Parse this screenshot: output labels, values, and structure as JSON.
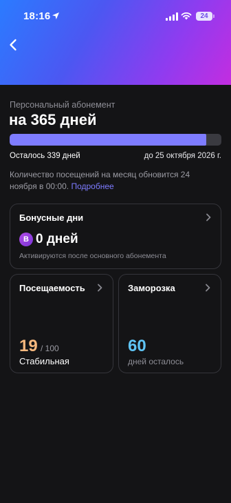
{
  "status_bar": {
    "time": "18:16",
    "battery": "24"
  },
  "subscription": {
    "label": "Персональный абонемент",
    "title": "на 365 дней",
    "progress_remaining_fraction": 0.93,
    "remaining": "Осталось 339 дней",
    "until": "до 25 октября 2026 г.",
    "visits_note": "Количество посещений на месяц обновится 24 ноября в 00:00.",
    "more_link": "Подробнее"
  },
  "bonus_card": {
    "title": "Бонусные дни",
    "badge_letter": "B",
    "value": "0 дней",
    "note": "Активируются после основного абонемента"
  },
  "attendance_card": {
    "title": "Посещаемость",
    "value": "19",
    "max": "/ 100",
    "status": "Стабильная"
  },
  "freeze_card": {
    "title": "Заморозка",
    "value": "60",
    "note": "дней осталось"
  },
  "colors": {
    "background": "#141416",
    "progress_fill": "#7e7cff",
    "link": "#7d7bff",
    "attendance_value": "#f6b87e",
    "freeze_value": "#5fc4f5",
    "bonus_badge": "#a043e2"
  },
  "icons": {
    "back": "back-chevron-icon",
    "location": "location-arrow-icon",
    "signal": "cellular-signal-icon",
    "wifi": "wifi-icon",
    "card_chevron": "chevron-right-icon"
  }
}
